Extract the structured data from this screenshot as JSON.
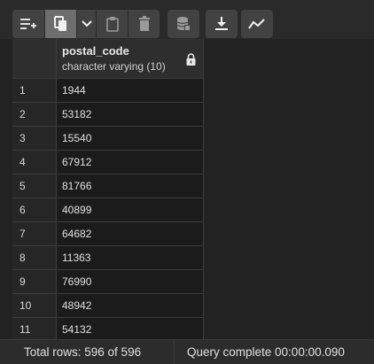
{
  "toolbar": {
    "buttons": [
      {
        "name": "add-row",
        "icon": "add-row-icon"
      },
      {
        "name": "copy",
        "icon": "copy-icon"
      },
      {
        "name": "copy-options",
        "icon": "chevron-down-icon"
      },
      {
        "name": "paste",
        "icon": "clipboard-icon"
      },
      {
        "name": "delete",
        "icon": "trash-icon"
      },
      {
        "name": "save-data",
        "icon": "database-save-icon"
      },
      {
        "name": "download",
        "icon": "download-icon"
      },
      {
        "name": "graph",
        "icon": "line-chart-icon"
      }
    ]
  },
  "grid": {
    "columns": [
      {
        "name": "postal_code",
        "type": "character varying (10)",
        "locked": true,
        "lock_icon": "lock-icon"
      }
    ],
    "rows": [
      {
        "num": "1",
        "postal_code": "1944"
      },
      {
        "num": "2",
        "postal_code": "53182"
      },
      {
        "num": "3",
        "postal_code": "15540"
      },
      {
        "num": "4",
        "postal_code": "67912"
      },
      {
        "num": "5",
        "postal_code": "81766"
      },
      {
        "num": "6",
        "postal_code": "40899"
      },
      {
        "num": "7",
        "postal_code": "64682"
      },
      {
        "num": "8",
        "postal_code": "11363"
      },
      {
        "num": "9",
        "postal_code": "76990"
      },
      {
        "num": "10",
        "postal_code": "48942"
      },
      {
        "num": "11",
        "postal_code": "54132"
      }
    ]
  },
  "status": {
    "total_rows": "Total rows: 596 of 596",
    "query": "Query complete 00:00:00.090"
  },
  "colors": {
    "background": "#222222",
    "button": "#424242",
    "button_active": "#6e6e6e",
    "border": "#3c3c3c"
  }
}
